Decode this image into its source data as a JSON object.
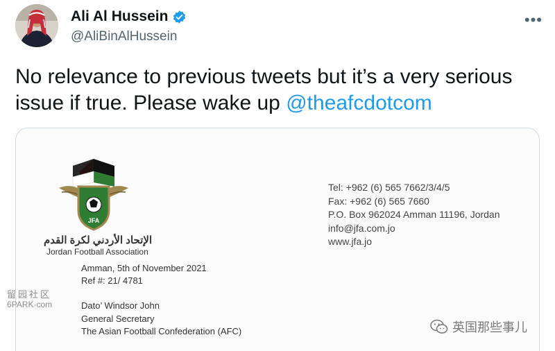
{
  "author": {
    "display_name": "Ali Al Hussein",
    "handle": "@AliBinAlHussein",
    "verified_icon": "verified-badge-icon"
  },
  "more_icon": "more-options-icon",
  "more_glyph": "•••",
  "tweet": {
    "text_before": "No relevance to previous tweets but it’s a very serious issue if true. Please wake up ",
    "mention": "@theafcdotcom"
  },
  "letter": {
    "assoc_arabic": "الإتحاد الأردني لكرة القدم",
    "assoc_english": "Jordan Football Association",
    "logo_text": "JFA",
    "contact": {
      "tel": "Tel: +962 (6) 565 7662/3/4/5",
      "fax": "Fax: +962 (6) 565 7660",
      "po_box": "P.O. Box 962024 Amman 11196, Jordan",
      "email": "info@jfa.com.jo",
      "web": "www.jfa.jo"
    },
    "date": "Amman, 5th of November 2021",
    "ref": "Ref #: 21/ 4781",
    "recipient_name": "Dato’ Windsor John",
    "recipient_title": "General Secretary",
    "recipient_org": "The Asian Football Confederation (AFC)"
  },
  "watermarks": {
    "left_top": "留园社区",
    "left_bottom": "6PARK·com",
    "right": "英国那些事儿",
    "right_icon": "wechat-icon"
  },
  "colors": {
    "link": "#1d9bf0",
    "verified": "#1d9bf0",
    "secondary_text": "#536471"
  }
}
